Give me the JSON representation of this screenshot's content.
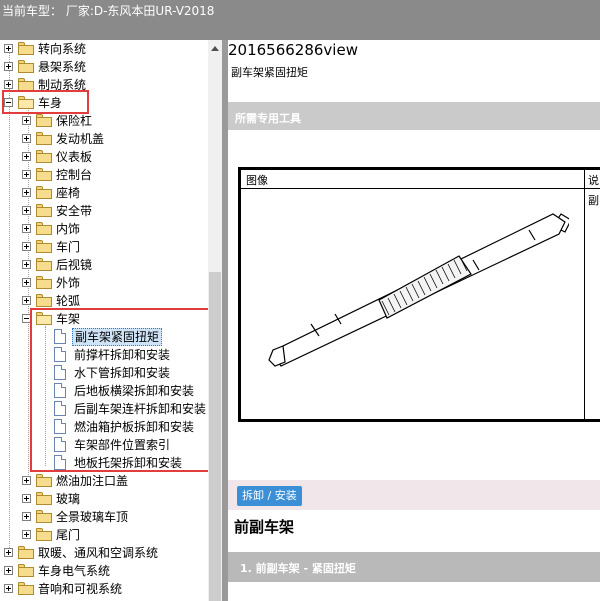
{
  "window": {
    "title": "当前车型：  厂家:D-东风本田UR-V2018"
  },
  "tree": {
    "top_items": [
      {
        "label": "转向系统",
        "expanded": false
      },
      {
        "label": "悬架系统",
        "expanded": false
      },
      {
        "label": "制动系统",
        "expanded": false
      },
      {
        "label": "车身",
        "expanded": true
      }
    ],
    "body_children": [
      {
        "label": "保险杠"
      },
      {
        "label": "发动机盖"
      },
      {
        "label": "仪表板"
      },
      {
        "label": "控制台"
      },
      {
        "label": "座椅"
      },
      {
        "label": "安全带"
      },
      {
        "label": "内饰"
      },
      {
        "label": "车门"
      },
      {
        "label": "后视镜"
      },
      {
        "label": "外饰"
      },
      {
        "label": "轮弧"
      },
      {
        "label": "车架",
        "expanded": true
      }
    ],
    "frame_docs": [
      {
        "label": "副车架紧固扭矩",
        "selected": true
      },
      {
        "label": "前撑杆拆卸和安装"
      },
      {
        "label": "水下管拆卸和安装"
      },
      {
        "label": "后地板横梁拆卸和安装"
      },
      {
        "label": "后副车架连杆拆卸和安装"
      },
      {
        "label": "燃油箱护板拆卸和安装"
      },
      {
        "label": "车架部件位置索引"
      },
      {
        "label": "地板托架拆卸和安装"
      }
    ],
    "after_frame": [
      {
        "label": "燃油加注口盖"
      },
      {
        "label": "玻璃"
      },
      {
        "label": "全景玻璃车顶"
      },
      {
        "label": "尾门"
      }
    ],
    "bottom_items": [
      {
        "label": "取暖、通风和空调系统"
      },
      {
        "label": "车身电气系统"
      },
      {
        "label": "音响和可视系统"
      }
    ]
  },
  "content": {
    "doc_id": "2016566286view",
    "subtitle": "副车架紧固扭矩",
    "tools_section": "所需专用工具",
    "table": {
      "col_image": "图像",
      "col_desc": "说",
      "row_desc": "副"
    },
    "remove_install_button": "拆卸 / 安装",
    "section_title": "前副车架",
    "step_bar": "1. 前副车架 - 紧固扭矩"
  },
  "colors": {
    "highlight_box": "#e23c3c",
    "button": "#3a8fd6",
    "selected_bg": "#cfe3f7"
  }
}
